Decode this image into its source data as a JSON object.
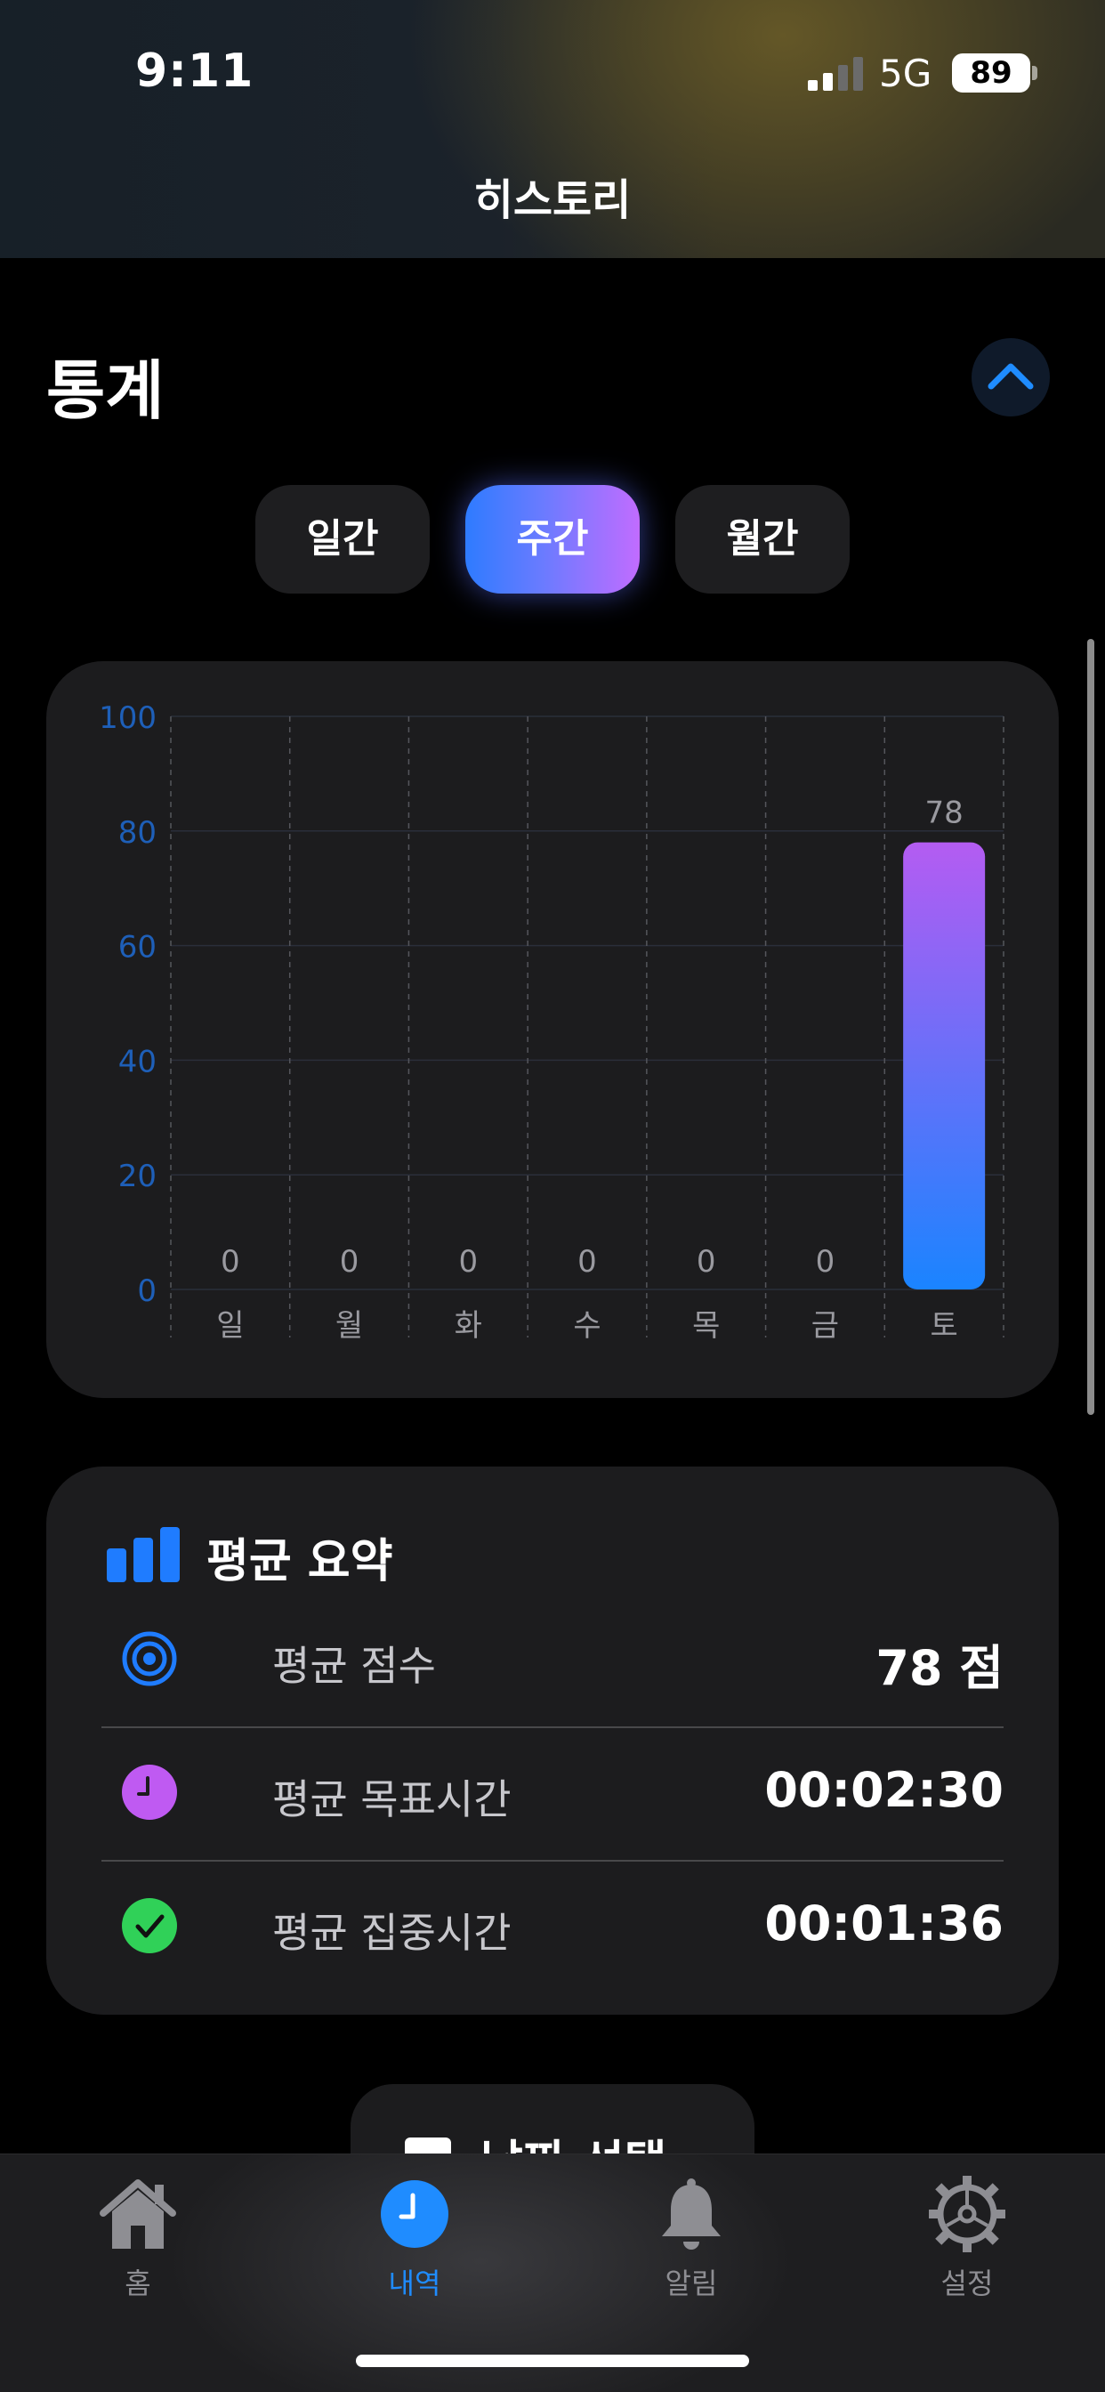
{
  "status_bar": {
    "time": "9:11",
    "network": "5G",
    "battery": "89"
  },
  "nav": {
    "title": "히스토리"
  },
  "stats": {
    "title": "통계",
    "segments": [
      {
        "label": "일간",
        "active": false
      },
      {
        "label": "주간",
        "active": true
      },
      {
        "label": "월간",
        "active": false
      }
    ]
  },
  "chart_data": {
    "type": "bar",
    "categories": [
      "일",
      "월",
      "화",
      "수",
      "목",
      "금",
      "토"
    ],
    "values": [
      0,
      0,
      0,
      0,
      0,
      0,
      78
    ],
    "ylim": [
      0,
      100
    ],
    "yticks": [
      0,
      20,
      40,
      60,
      80,
      100
    ],
    "grid": true,
    "colors": {
      "bar_top": "#b45cf2",
      "bar_bottom": "#1a84ff",
      "axis_label": "#1e5fb8"
    }
  },
  "summary": {
    "title": "평균 요약",
    "rows": [
      {
        "label": "평균 점수",
        "value": "78 점",
        "icon": "target-icon",
        "color": "#1f7cff"
      },
      {
        "label": "평균 목표시간",
        "value": "00:02:30",
        "icon": "clock-icon",
        "color": "#bf5af2"
      },
      {
        "label": "평균 집중시간",
        "value": "00:01:36",
        "icon": "checkmark-icon",
        "color": "#30d158"
      }
    ]
  },
  "date_button": {
    "label": "날짜 선택"
  },
  "tabbar": {
    "tabs": [
      {
        "label": "홈",
        "icon": "home-icon",
        "active": false
      },
      {
        "label": "내역",
        "icon": "clock-icon",
        "active": true
      },
      {
        "label": "알림",
        "icon": "bell-icon",
        "active": false
      },
      {
        "label": "설정",
        "icon": "gear-icon",
        "active": false
      }
    ]
  }
}
